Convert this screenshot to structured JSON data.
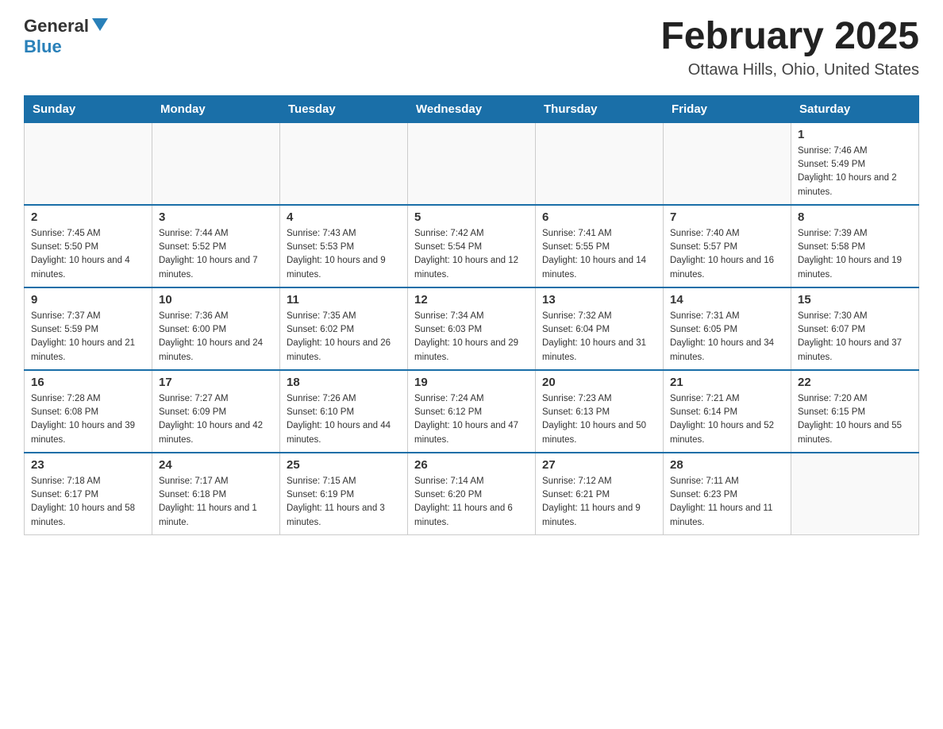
{
  "header": {
    "logo": {
      "general": "General",
      "blue": "Blue",
      "triangle": "▶"
    },
    "title": "February 2025",
    "location": "Ottawa Hills, Ohio, United States"
  },
  "weekdays": [
    "Sunday",
    "Monday",
    "Tuesday",
    "Wednesday",
    "Thursday",
    "Friday",
    "Saturday"
  ],
  "weeks": [
    [
      {
        "day": "",
        "info": ""
      },
      {
        "day": "",
        "info": ""
      },
      {
        "day": "",
        "info": ""
      },
      {
        "day": "",
        "info": ""
      },
      {
        "day": "",
        "info": ""
      },
      {
        "day": "",
        "info": ""
      },
      {
        "day": "1",
        "info": "Sunrise: 7:46 AM\nSunset: 5:49 PM\nDaylight: 10 hours and 2 minutes."
      }
    ],
    [
      {
        "day": "2",
        "info": "Sunrise: 7:45 AM\nSunset: 5:50 PM\nDaylight: 10 hours and 4 minutes."
      },
      {
        "day": "3",
        "info": "Sunrise: 7:44 AM\nSunset: 5:52 PM\nDaylight: 10 hours and 7 minutes."
      },
      {
        "day": "4",
        "info": "Sunrise: 7:43 AM\nSunset: 5:53 PM\nDaylight: 10 hours and 9 minutes."
      },
      {
        "day": "5",
        "info": "Sunrise: 7:42 AM\nSunset: 5:54 PM\nDaylight: 10 hours and 12 minutes."
      },
      {
        "day": "6",
        "info": "Sunrise: 7:41 AM\nSunset: 5:55 PM\nDaylight: 10 hours and 14 minutes."
      },
      {
        "day": "7",
        "info": "Sunrise: 7:40 AM\nSunset: 5:57 PM\nDaylight: 10 hours and 16 minutes."
      },
      {
        "day": "8",
        "info": "Sunrise: 7:39 AM\nSunset: 5:58 PM\nDaylight: 10 hours and 19 minutes."
      }
    ],
    [
      {
        "day": "9",
        "info": "Sunrise: 7:37 AM\nSunset: 5:59 PM\nDaylight: 10 hours and 21 minutes."
      },
      {
        "day": "10",
        "info": "Sunrise: 7:36 AM\nSunset: 6:00 PM\nDaylight: 10 hours and 24 minutes."
      },
      {
        "day": "11",
        "info": "Sunrise: 7:35 AM\nSunset: 6:02 PM\nDaylight: 10 hours and 26 minutes."
      },
      {
        "day": "12",
        "info": "Sunrise: 7:34 AM\nSunset: 6:03 PM\nDaylight: 10 hours and 29 minutes."
      },
      {
        "day": "13",
        "info": "Sunrise: 7:32 AM\nSunset: 6:04 PM\nDaylight: 10 hours and 31 minutes."
      },
      {
        "day": "14",
        "info": "Sunrise: 7:31 AM\nSunset: 6:05 PM\nDaylight: 10 hours and 34 minutes."
      },
      {
        "day": "15",
        "info": "Sunrise: 7:30 AM\nSunset: 6:07 PM\nDaylight: 10 hours and 37 minutes."
      }
    ],
    [
      {
        "day": "16",
        "info": "Sunrise: 7:28 AM\nSunset: 6:08 PM\nDaylight: 10 hours and 39 minutes."
      },
      {
        "day": "17",
        "info": "Sunrise: 7:27 AM\nSunset: 6:09 PM\nDaylight: 10 hours and 42 minutes."
      },
      {
        "day": "18",
        "info": "Sunrise: 7:26 AM\nSunset: 6:10 PM\nDaylight: 10 hours and 44 minutes."
      },
      {
        "day": "19",
        "info": "Sunrise: 7:24 AM\nSunset: 6:12 PM\nDaylight: 10 hours and 47 minutes."
      },
      {
        "day": "20",
        "info": "Sunrise: 7:23 AM\nSunset: 6:13 PM\nDaylight: 10 hours and 50 minutes."
      },
      {
        "day": "21",
        "info": "Sunrise: 7:21 AM\nSunset: 6:14 PM\nDaylight: 10 hours and 52 minutes."
      },
      {
        "day": "22",
        "info": "Sunrise: 7:20 AM\nSunset: 6:15 PM\nDaylight: 10 hours and 55 minutes."
      }
    ],
    [
      {
        "day": "23",
        "info": "Sunrise: 7:18 AM\nSunset: 6:17 PM\nDaylight: 10 hours and 58 minutes."
      },
      {
        "day": "24",
        "info": "Sunrise: 7:17 AM\nSunset: 6:18 PM\nDaylight: 11 hours and 1 minute."
      },
      {
        "day": "25",
        "info": "Sunrise: 7:15 AM\nSunset: 6:19 PM\nDaylight: 11 hours and 3 minutes."
      },
      {
        "day": "26",
        "info": "Sunrise: 7:14 AM\nSunset: 6:20 PM\nDaylight: 11 hours and 6 minutes."
      },
      {
        "day": "27",
        "info": "Sunrise: 7:12 AM\nSunset: 6:21 PM\nDaylight: 11 hours and 9 minutes."
      },
      {
        "day": "28",
        "info": "Sunrise: 7:11 AM\nSunset: 6:23 PM\nDaylight: 11 hours and 11 minutes."
      },
      {
        "day": "",
        "info": ""
      }
    ]
  ]
}
